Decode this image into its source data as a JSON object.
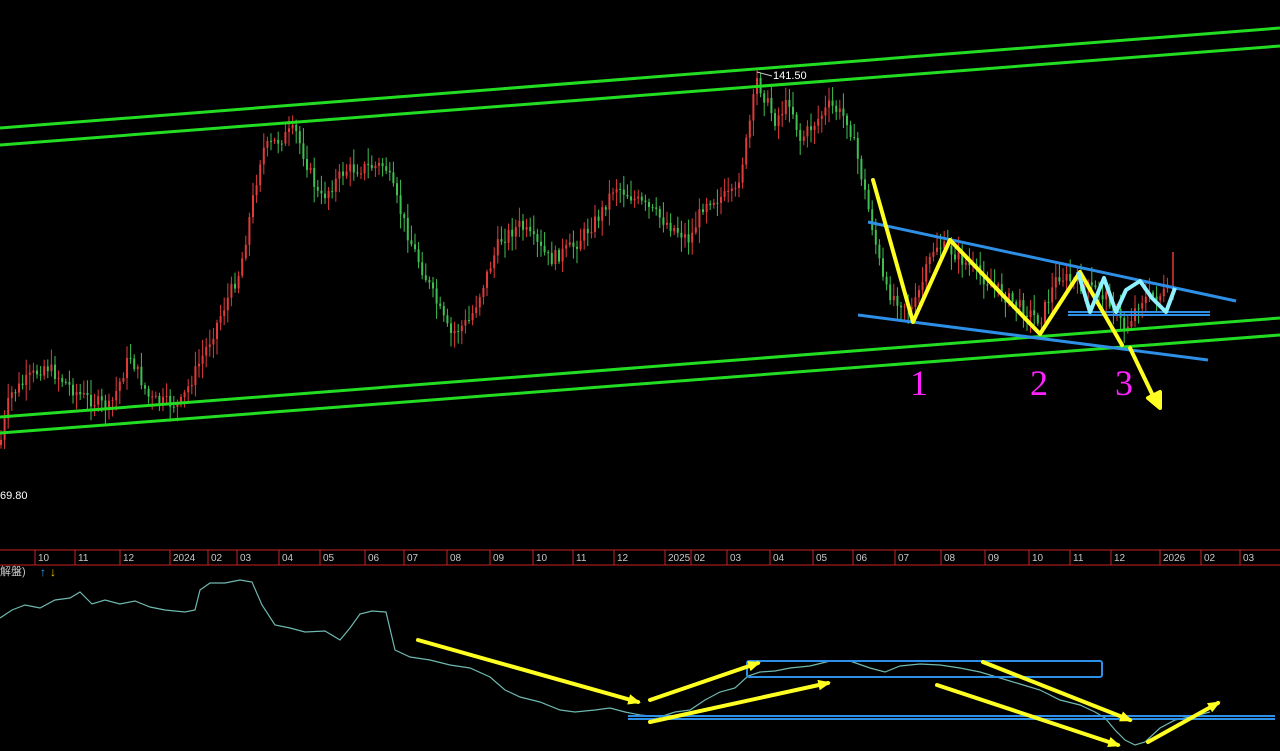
{
  "colors": {
    "background": "#000000",
    "up_candle": "#e03b3b",
    "down_candle": "#3fbf4f",
    "channel": "#22dd22",
    "annotation": "#ffff22",
    "trendline": "#2e8fe6",
    "zigzag": "#8ff3ff",
    "axis": "#cc2222",
    "axis_text": "#c8c8c8",
    "indicator_line": "#6fb8b0",
    "wave_label": "#ff22ff"
  },
  "price_chart": {
    "high_label": "141.50",
    "low_label": "69.80",
    "wave_labels": [
      "1",
      "2",
      "3"
    ]
  },
  "time_axis": {
    "ticks": [
      {
        "label": "10"
      },
      {
        "label": "11"
      },
      {
        "label": "12"
      },
      {
        "label": "2024"
      },
      {
        "label": "02"
      },
      {
        "label": "03"
      },
      {
        "label": "04"
      },
      {
        "label": "05"
      },
      {
        "label": "06"
      },
      {
        "label": "07"
      },
      {
        "label": "08"
      },
      {
        "label": "09"
      },
      {
        "label": "10"
      },
      {
        "label": "11"
      },
      {
        "label": "12"
      },
      {
        "label": "2025"
      },
      {
        "label": "02"
      },
      {
        "label": "03"
      },
      {
        "label": "04"
      },
      {
        "label": "05"
      },
      {
        "label": "06"
      },
      {
        "label": "07"
      },
      {
        "label": "08"
      },
      {
        "label": "09"
      },
      {
        "label": "10"
      },
      {
        "label": "11"
      },
      {
        "label": "12"
      },
      {
        "label": "2026"
      },
      {
        "label": "02"
      },
      {
        "label": "03"
      }
    ]
  },
  "indicator_panel": {
    "title": "解盤)",
    "up_arrow": "↑",
    "down_arrow": "↓"
  }
}
